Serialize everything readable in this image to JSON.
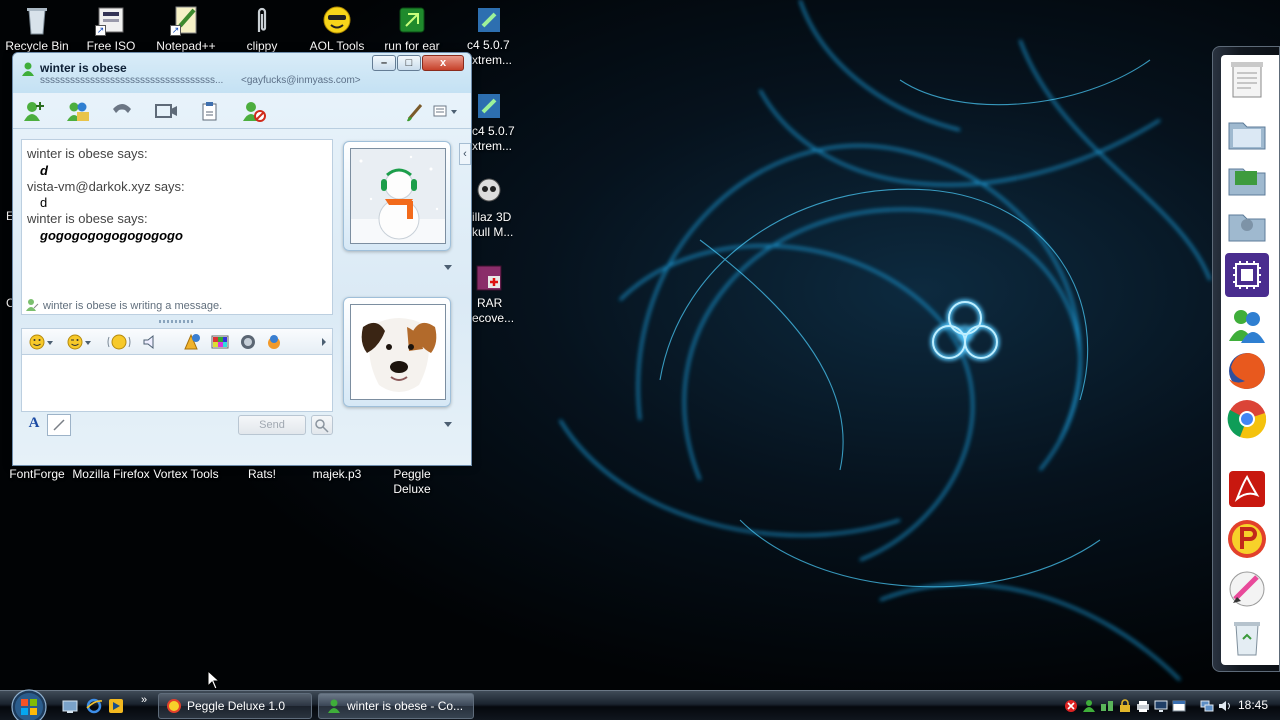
{
  "desktop": {
    "icons": [
      {
        "label": "Recycle Bin",
        "icon": "recycle-bin-icon"
      },
      {
        "label": "Free ISO",
        "icon": "free-iso-icon"
      },
      {
        "label": "Notepad++",
        "icon": "notepad-plus-plus-icon"
      },
      {
        "label": "clippy",
        "icon": "clippy-icon"
      },
      {
        "label": "AOL Tools",
        "icon": "aol-tools-icon"
      },
      {
        "label": "run for ear",
        "icon": "run-for-ear-icon"
      },
      {
        "label": "FontForge",
        "icon": "fontforge-icon"
      },
      {
        "label": "Mozilla Firefox",
        "icon": "firefox-icon"
      },
      {
        "label": "Vortex Tools",
        "icon": "vortex-tools-icon"
      },
      {
        "label": "Rats!",
        "icon": "rats-icon"
      },
      {
        "label": "majek.p3",
        "icon": "majek-icon"
      },
      {
        "label": "Peggle Deluxe",
        "icon": "peggle-icon"
      }
    ],
    "partial_labels": {
      "c4_a1": "c4 5.0.7",
      "c4_a2": "xtrem...",
      "c4_b1": "c4 5.0.7",
      "c4_b2": "xtrem...",
      "skull1": "illaz 3D",
      "skull2": "kull M...",
      "rar1": "RAR",
      "rar2": "ecove...",
      "edge_b": "E",
      "edge_c": "C"
    }
  },
  "messenger": {
    "title": "winter is obese",
    "personal_message": "sssssssssssssssssssssssssssssssssss...",
    "email": "<gayfucks@inmyass.com>",
    "window_buttons": {
      "minimize": "–",
      "maximize": "□",
      "close": "x"
    },
    "toolbar_icons": [
      "invite-contact-icon",
      "share-folder-icon",
      "call-icon",
      "video-call-icon",
      "activities-icon",
      "block-contact-icon",
      "paint-icon",
      "display-options-icon"
    ],
    "conversation": [
      {
        "sender": "winter is obese says:",
        "text": "d",
        "style": "bold-italic"
      },
      {
        "sender": "vista-vm@darkok.xyz says:",
        "text": "d",
        "style": "normal"
      },
      {
        "sender": "winter is obese says:",
        "text": "gogogogogogogogogo",
        "style": "bold-italic"
      }
    ],
    "typing_status": "winter is obese is writing a message.",
    "format_icons": [
      "emoticon-icon",
      "wink-icon",
      "nudge-icon",
      "voice-clip-icon",
      "gift-icon",
      "background-icon",
      "games-icon",
      "action-icon"
    ],
    "compose_value": "",
    "font_button": "A",
    "send_label": "Send",
    "collapse_symbol": "‹"
  },
  "dock": {
    "icons": [
      "notepad-dock-icon",
      "folder-dock-icon",
      "green-folder-dock-icon",
      "settings-folder-dock-icon",
      "chip-dock-icon",
      "messenger-dock-icon",
      "firefox-dock-icon",
      "chrome-dock-icon",
      "acrobat-dock-icon",
      "peggle-dock-icon",
      "paint-dock-icon",
      "trash-dock-icon"
    ]
  },
  "taskbar": {
    "quicklaunch_more": "»",
    "tasks": [
      {
        "label": "Peggle Deluxe 1.0",
        "icon": "peggle-task-icon"
      },
      {
        "label": "winter is obese - Co...",
        "icon": "messenger-task-icon"
      }
    ],
    "clock": "18:45"
  },
  "colors": {
    "accent": "#1ea7e8",
    "taskbar": "#1a232e",
    "window": "#dbeaf5"
  }
}
